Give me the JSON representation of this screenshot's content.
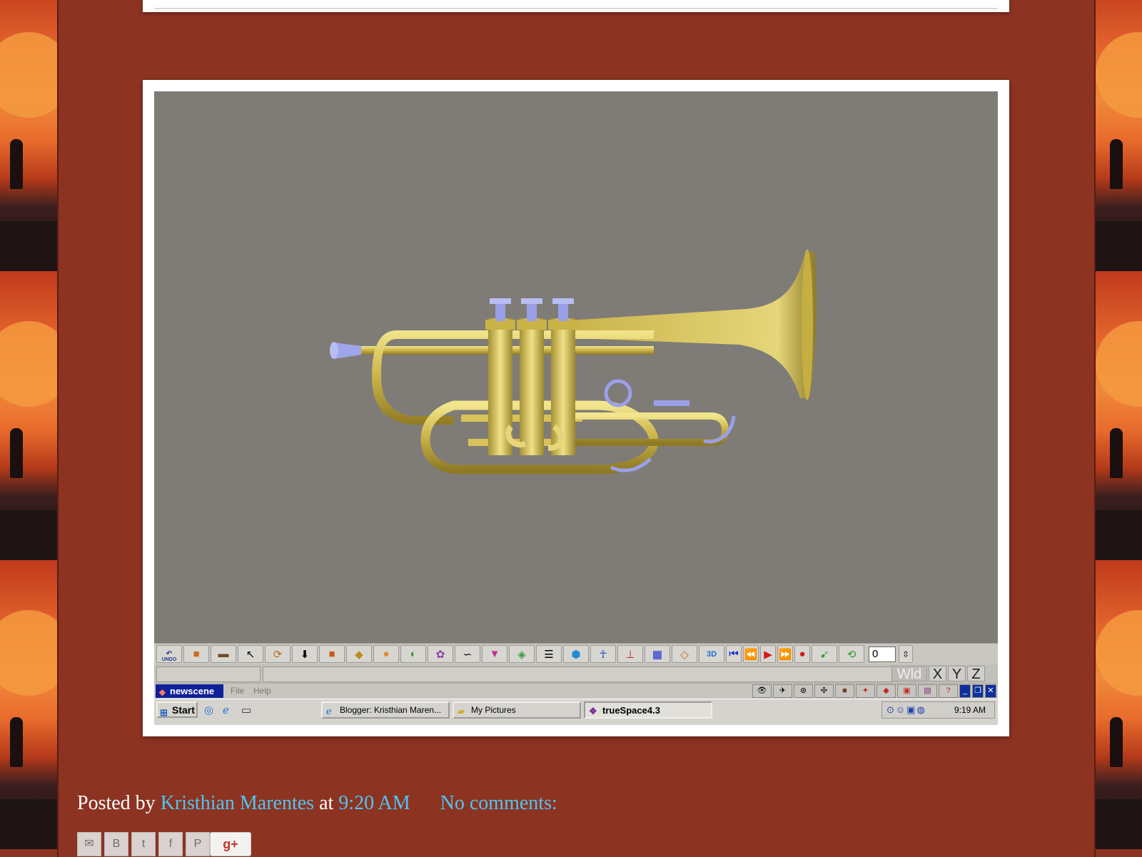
{
  "colors": {
    "page_bg": "#8c3322",
    "link": "#4fc6f2",
    "screen_bg": "#807d79",
    "trumpet": "#c9b34a",
    "valve_accent": "#9aa0e8"
  },
  "app": {
    "toolbar": {
      "undo_label": "UNDO",
      "frame_value": "0",
      "icons": [
        "undo-icon",
        "object-icon",
        "library-icon",
        "pointer-icon",
        "rotate-icon",
        "move-down-icon",
        "box-icon",
        "lathe-icon",
        "sphere-icon",
        "paint-icon",
        "deform-icon",
        "curve-icon",
        "funnel-icon",
        "material-icon",
        "list-icon",
        "cube-icon",
        "figure-icon",
        "axes-icon",
        "grid-icon",
        "render-icon",
        "3d-icon",
        "skip-start-icon",
        "rewind-icon",
        "play-icon",
        "fast-forward-icon",
        "record-icon",
        "keyframe-icon",
        "loop-icon"
      ]
    },
    "axes": {
      "wld": "Wld",
      "x": "X",
      "y": "Y",
      "z": "Z"
    },
    "scene_title": "newscene",
    "menu": {
      "file": "File",
      "help": "Help"
    },
    "taskbar": {
      "start": "Start",
      "tasks": [
        {
          "label": "Blogger: Kristhian Maren...",
          "icon": "ie-icon"
        },
        {
          "label": "My Pictures",
          "icon": "folder-icon"
        },
        {
          "label": "trueSpace4.3",
          "icon": "truespace-icon",
          "active": true
        }
      ],
      "clock": "9:19 AM"
    }
  },
  "post": {
    "posted_by": "Posted by",
    "author": "Kristhian Marentes",
    "at": "at",
    "time": "9:20 AM",
    "comments": "No comments:"
  }
}
